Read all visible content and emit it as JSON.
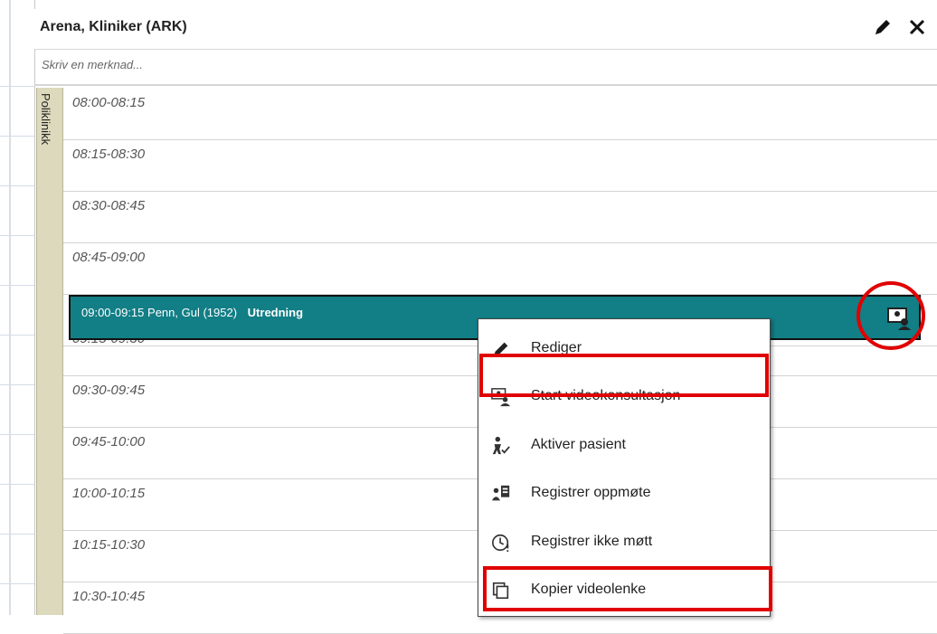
{
  "header": {
    "title": "Arena, Kliniker (ARK)",
    "edit_icon": "pencil-icon",
    "close_icon": "close-icon"
  },
  "note": {
    "placeholder": "Skriv en merknad..."
  },
  "vertical_label": "Poliklinikk",
  "slots": [
    "08:00-08:15",
    "08:15-08:30",
    "08:30-08:45",
    "08:45-09:00",
    "",
    "09:15-09:30",
    "09:30-09:45",
    "09:45-10:00",
    "10:00-10:15",
    "10:15-10:30",
    "10:30-10:45"
  ],
  "appointment": {
    "time": "09:00-09:15",
    "patient": "Penn, Gul (1952)",
    "type": "Utredning",
    "icon": "video-consultation-icon",
    "color": "#127e86"
  },
  "context_menu": {
    "items": [
      {
        "label": "Rediger",
        "icon": "pencil-icon"
      },
      {
        "label": "Start videokonsultasjon",
        "icon": "video-consultation-icon"
      },
      {
        "label": "Aktiver pasient",
        "icon": "activate-patient-icon"
      },
      {
        "label": "Registrer oppmøte",
        "icon": "register-attendance-icon"
      },
      {
        "label": "Registrer ikke møtt",
        "icon": "clock-alert-icon"
      },
      {
        "label": "Kopier videolenke",
        "icon": "copy-icon"
      }
    ]
  },
  "highlight_color": "#e00000"
}
